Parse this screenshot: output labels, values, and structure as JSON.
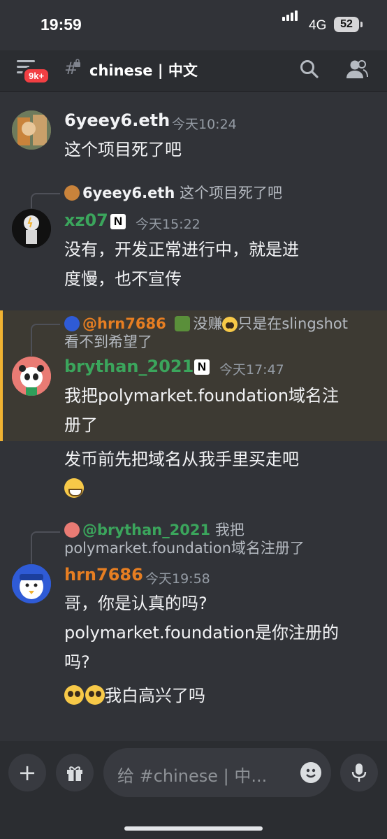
{
  "status_bar": {
    "time": "19:59",
    "network": "4G",
    "battery": "52"
  },
  "header": {
    "unread_badge": "9k+",
    "channel_title": "chinese | 中文"
  },
  "messages": [
    {
      "username": "6yeey6.eth",
      "timestamp": "今天10:24",
      "text": "这个项目死了吧"
    },
    {
      "reply_to": {
        "name": "6yeey6.eth",
        "text": "这个项目死了吧"
      },
      "username": "xz07",
      "tag": "N",
      "timestamp": "今天15:22",
      "text_line1": "没有，开发正常进行中，就是进",
      "text_line2": "度慢，也不宣传"
    },
    {
      "reply_to": {
        "name": "@hrn7686",
        "text_a": "没赚",
        "text_b": "只是在slingshot",
        "text_line2": "看不到希望了"
      },
      "username": "brythan_2021",
      "tag": "N",
      "timestamp": "今天17:47",
      "text_line1": "我把polymarket.foundation域名注",
      "text_line2": "册了",
      "followup_line1": "发币前先把域名从我手里买走吧"
    },
    {
      "reply_to": {
        "name": "@brythan_2021",
        "text_a": "我把",
        "text_line2": "polymarket.foundation域名注册了"
      },
      "username": "hrn7686",
      "timestamp": "今天19:58",
      "text_line1": "哥，你是认真的吗?",
      "text_line2": "polymarket.foundation是你注册的",
      "text_line3": "吗?",
      "followup_text": "我白高兴了吗"
    }
  ],
  "composer": {
    "placeholder": "给 #chinese | 中..."
  },
  "colors": {
    "background": "#313338",
    "username_default": "#f2f3f5",
    "username_green": "#3ba55c",
    "username_orange": "#e67e22",
    "highlight_bar": "#f0b232"
  }
}
